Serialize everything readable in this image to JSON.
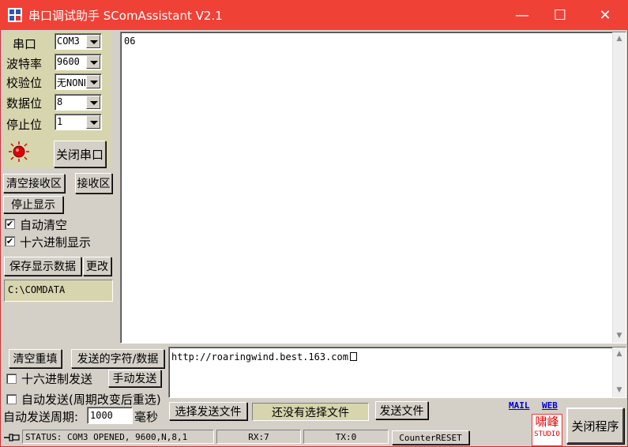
{
  "window": {
    "title": "串口调试助手 SComAssistant V2.1",
    "minimize": "—",
    "maximize": "☐",
    "close": "✕"
  },
  "settings": {
    "port_label": "串口",
    "port_value": "COM3",
    "baud_label": "波特率",
    "baud_value": "9600",
    "parity_label": "校验位",
    "parity_value": "无NONE",
    "databits_label": "数据位",
    "databits_value": "8",
    "stopbits_label": "停止位",
    "stopbits_value": "1",
    "close_port": "关闭串口"
  },
  "receive": {
    "clear": "清空接收区",
    "tag": "接收区",
    "stop_display": "停止显示",
    "auto_clear": "自动清空",
    "auto_clear_checked": true,
    "hex_display": "十六进制显示",
    "hex_display_checked": true,
    "save_data": "保存显示数据",
    "change": "更改",
    "path": "C:\\COMDATA",
    "content": "06"
  },
  "send": {
    "clear_refill": "清空重填",
    "tag": "发送的字符/数据",
    "hex_send": "十六进制发送",
    "hex_send_checked": false,
    "manual_send": "手动发送",
    "auto_send": "自动发送(周期改变后重选)",
    "auto_send_checked": false,
    "period_label": "自动发送周期:",
    "period_value": "1000",
    "period_unit": "毫秒",
    "content": "http://roaringwind.best.163.com",
    "select_file": "选择发送文件",
    "file_status": "还没有选择文件",
    "send_file": "发送文件",
    "mail": "MAIL",
    "web": "WEB",
    "logo_top": "啸峰",
    "logo_bottom": "STUDIO",
    "exit": "关闭程序"
  },
  "status": {
    "text": "STATUS: COM3 OPENED, 9600,N,8,1",
    "rx": "RX:7",
    "tx": "TX:0",
    "counter_reset": "CounterRESET"
  },
  "colors": {
    "titlebar": "#ef4136",
    "panel": "#d7d5ad",
    "led": "#e00000"
  }
}
